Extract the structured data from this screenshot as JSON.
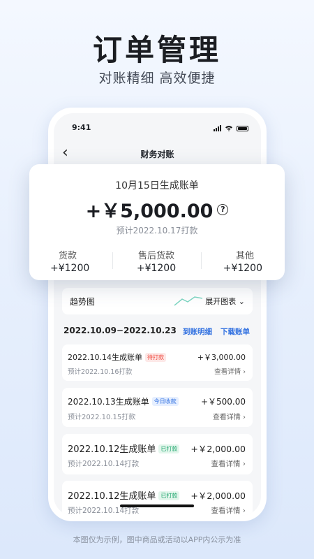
{
  "hero": {
    "title": "订单管理",
    "subtitle": "对账精细 高效便捷"
  },
  "status_bar": {
    "time": "9:41"
  },
  "nav": {
    "title": "财务对账"
  },
  "summary_card": {
    "date_title": "10月15日生成账单",
    "amount": "+￥5,000.00",
    "help": "?",
    "eta": "预计2022.10.17打款",
    "stats": [
      {
        "label": "货款",
        "value": "+¥1200"
      },
      {
        "label": "售后货款",
        "value": "+¥1200"
      },
      {
        "label": "其他",
        "value": "+¥1200"
      }
    ]
  },
  "trend": {
    "label": "趋势图",
    "toggle": "展开图表",
    "line_color": "#7fd6c2"
  },
  "period": {
    "range": "2022.10.09−2022.10.23",
    "link_detail": "到账明细",
    "link_download": "下载账单"
  },
  "items": [
    {
      "title": "2022.10.14生成账单",
      "tag": "待打款",
      "tag_fg": "#f0473c",
      "tag_bg": "#fde8e7",
      "amount": "+￥3,000.00",
      "eta": "预计2022.10.16打款",
      "detail": "查看详情"
    },
    {
      "title": "2022.10.13生成账单",
      "tag": "今日收款",
      "tag_fg": "#2f6fe0",
      "tag_bg": "#e6efff",
      "amount": "+￥500.00",
      "eta": "预计2022.10.15打款",
      "detail": "查看详情"
    },
    {
      "title": "2022.10.12生成账单",
      "tag": "已打款",
      "tag_fg": "#1aa46a",
      "tag_bg": "#e3f6ec",
      "amount": "+￥2,000.00",
      "eta": "预计2022.10.14打款",
      "detail": "查看详情"
    },
    {
      "title": "2022.10.12生成账单",
      "tag": "已打款",
      "tag_fg": "#1aa46a",
      "tag_bg": "#e3f6ec",
      "amount": "+￥2,000.00",
      "eta": "预计2022.10.14打款",
      "detail": "查看详情"
    }
  ],
  "footnote": "本图仅为示例，图中商品或活动以APP内公示为准"
}
